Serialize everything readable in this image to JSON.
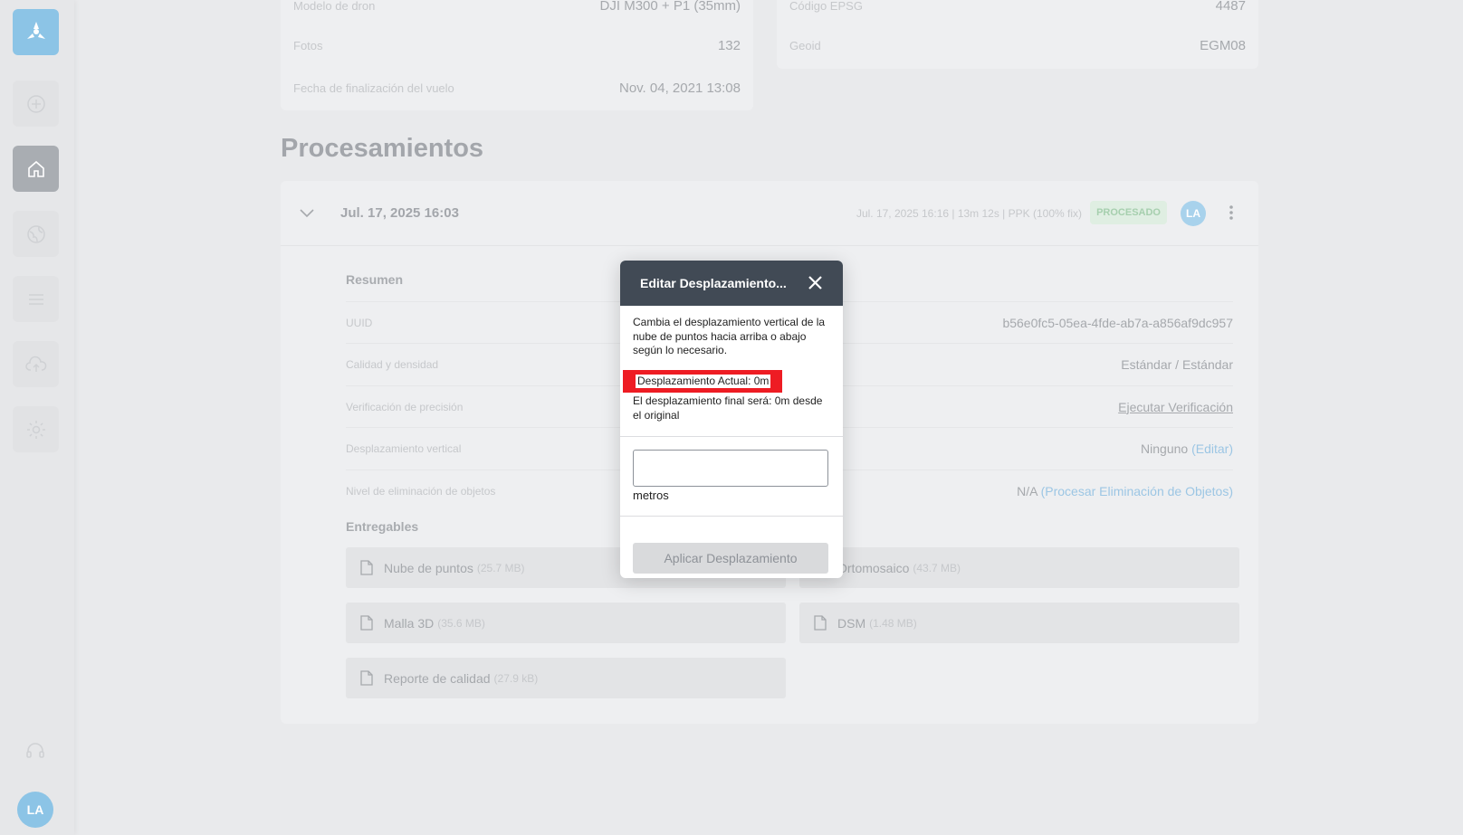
{
  "sidebar": {
    "avatar_initials": "LA"
  },
  "flight_info": {
    "drone_model_label": "Modelo de dron",
    "drone_model_value": "DJI M300 + P1 (35mm)",
    "photos_label": "Fotos",
    "photos_value": "132",
    "flight_end_label": "Fecha de finalización del vuelo",
    "flight_end_value": "Nov. 04, 2021 13:08",
    "epsg_label": "Código EPSG",
    "epsg_value": "4487",
    "geoid_label": "Geoid",
    "geoid_value": "EGM08"
  },
  "processing": {
    "section_title": "Procesamientos",
    "date": "Jul. 17, 2025 16:03",
    "meta": "Jul. 17, 2025 16:16 | 13m 12s | PPK (100% fix)",
    "status_badge": "PROCESADO",
    "avatar_initials": "LA",
    "summary_title": "Resumen",
    "summary_rows": [
      {
        "label": "UUID",
        "value": "b56e0fc5-05ea-4fde-ab7a-a856af9dc957"
      },
      {
        "label": "Calidad y densidad",
        "value": "Estándar / Estándar"
      },
      {
        "label": "Verificación de precisión",
        "value": "Ejecutar Verificación"
      },
      {
        "label": "Desplazamiento vertical",
        "value": "Ninguno",
        "link": "(Editar)"
      },
      {
        "label": "Nivel de eliminación de objetos",
        "value": "N/A",
        "link": "(Procesar Eliminación de Objetos)"
      }
    ],
    "deliverables_title": "Entregables",
    "deliverables": [
      {
        "name": "Nube de puntos",
        "size": "(25.7 MB)"
      },
      {
        "name": "Ortomosaico",
        "size": "(43.7 MB)"
      },
      {
        "name": "Malla 3D",
        "size": "(35.6 MB)"
      },
      {
        "name": "DSM",
        "size": "(1.48 MB)"
      },
      {
        "name": "Reporte de calidad",
        "size": "(27.9 kB)"
      }
    ]
  },
  "modal": {
    "title": "Editar Desplazamiento...",
    "description": "Cambia el desplazamiento vertical de la nube de puntos hacia arriba o abajo según lo necesario.",
    "current_offset": "Desplazamiento Actual: 0m",
    "final_offset": "El desplazamiento final será: 0m desde el original",
    "input_value": "",
    "unit": "metros",
    "apply_label": "Aplicar Desplazamiento"
  },
  "colors": {
    "accent": "#8cc4e6",
    "modal_header": "#414a55",
    "highlight": "#ee1c23"
  }
}
